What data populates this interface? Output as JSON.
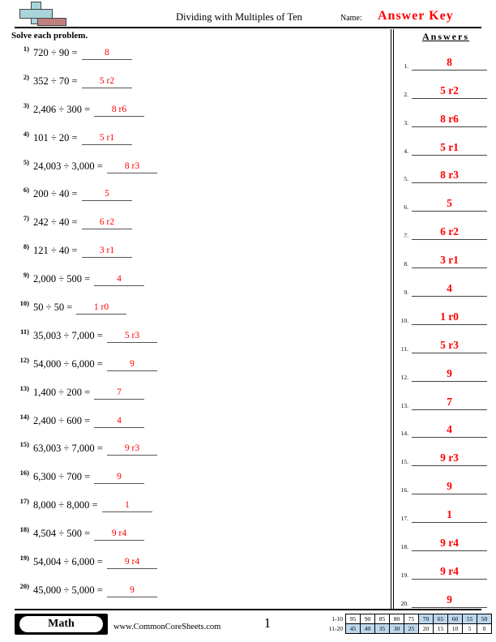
{
  "header": {
    "title": "Dividing with Multiples of Ten",
    "name_label": "Name:",
    "answer_key": "Answer Key",
    "logo": "math-worksheet-logo"
  },
  "subheader": {
    "instructions": "Solve each problem.",
    "answers_heading": "Answers"
  },
  "problems": [
    {
      "num": "1)",
      "expr": "720 ÷ 90 =",
      "answer": "8"
    },
    {
      "num": "2)",
      "expr": "352 ÷ 70 =",
      "answer": "5 r2"
    },
    {
      "num": "3)",
      "expr": "2,406 ÷ 300 =",
      "answer": "8 r6"
    },
    {
      "num": "4)",
      "expr": "101 ÷ 20 =",
      "answer": "5 r1"
    },
    {
      "num": "5)",
      "expr": "24,003 ÷ 3,000 =",
      "answer": "8 r3"
    },
    {
      "num": "6)",
      "expr": "200 ÷ 40 =",
      "answer": "5"
    },
    {
      "num": "7)",
      "expr": "242 ÷ 40 =",
      "answer": "6 r2"
    },
    {
      "num": "8)",
      "expr": "121 ÷ 40 =",
      "answer": "3 r1"
    },
    {
      "num": "9)",
      "expr": "2,000 ÷ 500 =",
      "answer": "4"
    },
    {
      "num": "10)",
      "expr": "50 ÷ 50 =",
      "answer": "1 r0"
    },
    {
      "num": "11)",
      "expr": "35,003 ÷ 7,000 =",
      "answer": "5 r3"
    },
    {
      "num": "12)",
      "expr": "54,000 ÷ 6,000 =",
      "answer": "9"
    },
    {
      "num": "13)",
      "expr": "1,400 ÷ 200 =",
      "answer": "7"
    },
    {
      "num": "14)",
      "expr": "2,400 ÷ 600 =",
      "answer": "4"
    },
    {
      "num": "15)",
      "expr": "63,003 ÷ 7,000 =",
      "answer": "9 r3"
    },
    {
      "num": "16)",
      "expr": "6,300 ÷ 700 =",
      "answer": "9"
    },
    {
      "num": "17)",
      "expr": "8,000 ÷ 8,000 =",
      "answer": "1"
    },
    {
      "num": "18)",
      "expr": "4,504 ÷ 500 =",
      "answer": "9 r4"
    },
    {
      "num": "19)",
      "expr": "54,004 ÷ 6,000 =",
      "answer": "9 r4"
    },
    {
      "num": "20)",
      "expr": "45,000 ÷ 5,000 =",
      "answer": "9"
    }
  ],
  "answers": [
    {
      "num": "1.",
      "value": "8"
    },
    {
      "num": "2.",
      "value": "5 r2"
    },
    {
      "num": "3.",
      "value": "8 r6"
    },
    {
      "num": "4.",
      "value": "5 r1"
    },
    {
      "num": "5.",
      "value": "8 r3"
    },
    {
      "num": "6.",
      "value": "5"
    },
    {
      "num": "7.",
      "value": "6 r2"
    },
    {
      "num": "8.",
      "value": "3 r1"
    },
    {
      "num": "9.",
      "value": "4"
    },
    {
      "num": "10.",
      "value": "1 r0"
    },
    {
      "num": "11.",
      "value": "5 r3"
    },
    {
      "num": "12.",
      "value": "9"
    },
    {
      "num": "13.",
      "value": "7"
    },
    {
      "num": "14.",
      "value": "4"
    },
    {
      "num": "15.",
      "value": "9 r3"
    },
    {
      "num": "16.",
      "value": "9"
    },
    {
      "num": "17.",
      "value": "1"
    },
    {
      "num": "18.",
      "value": "9 r4"
    },
    {
      "num": "19.",
      "value": "9 r4"
    },
    {
      "num": "20.",
      "value": "9"
    }
  ],
  "footer": {
    "subject_badge": "Math",
    "site_url": "www.CommonCoreSheets.com",
    "page_number": "1"
  },
  "grade_scale": {
    "rows": [
      {
        "label": "1-10",
        "cells": [
          {
            "value": "95",
            "highlighted": false
          },
          {
            "value": "90",
            "highlighted": false
          },
          {
            "value": "85",
            "highlighted": false
          },
          {
            "value": "80",
            "highlighted": false
          },
          {
            "value": "75",
            "highlighted": false
          },
          {
            "value": "70",
            "highlighted": true
          },
          {
            "value": "65",
            "highlighted": true
          },
          {
            "value": "60",
            "highlighted": true
          },
          {
            "value": "55",
            "highlighted": true
          },
          {
            "value": "50",
            "highlighted": true
          }
        ]
      },
      {
        "label": "11-20",
        "cells": [
          {
            "value": "45",
            "highlighted": true
          },
          {
            "value": "40",
            "highlighted": true
          },
          {
            "value": "35",
            "highlighted": true
          },
          {
            "value": "30",
            "highlighted": true
          },
          {
            "value": "25",
            "highlighted": true
          },
          {
            "value": "20",
            "highlighted": false
          },
          {
            "value": "15",
            "highlighted": false
          },
          {
            "value": "10",
            "highlighted": false
          },
          {
            "value": "5",
            "highlighted": false
          },
          {
            "value": "0",
            "highlighted": false
          }
        ]
      }
    ]
  },
  "colors": {
    "answer_red": "#ff0000",
    "logo_blue": "#a8d4dc",
    "logo_red": "#c08080",
    "scale_highlight": "#bdd7ee"
  }
}
